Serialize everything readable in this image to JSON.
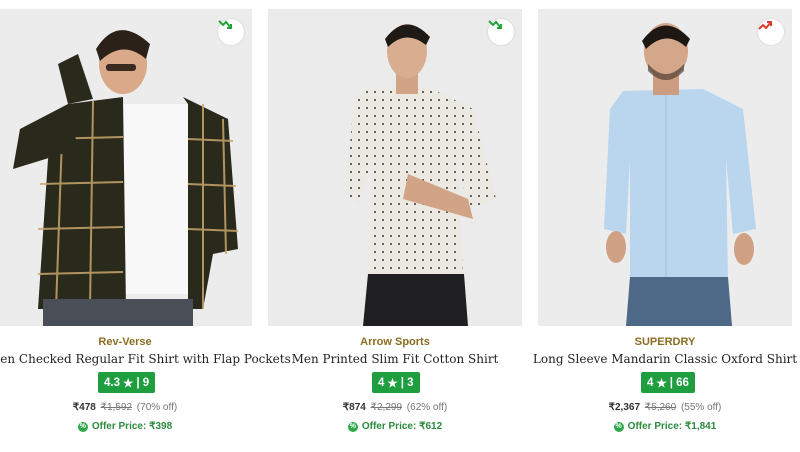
{
  "products": [
    {
      "brand": "Rev-Verse",
      "title": "Men Checked Regular Fit Shirt with Flap Pockets",
      "rating": "4.3",
      "reviews": "| 9",
      "price": "₹478",
      "mrp": "₹1,592",
      "discount": "(70% off)",
      "offer_price": "Offer Price: ₹398",
      "trend": "trending-down-icon",
      "trend_color": "#22a33a"
    },
    {
      "brand": "Arrow Sports",
      "title": "Men Printed Slim Fit Cotton Shirt",
      "rating": "4",
      "reviews": "| 3",
      "price": "₹874",
      "mrp": "₹2,299",
      "discount": "(62% off)",
      "offer_price": "Offer Price: ₹612",
      "trend": "trending-down-icon",
      "trend_color": "#22a33a"
    },
    {
      "brand": "SUPERDRY",
      "title": "Long Sleeve Mandarin Classic Oxford Shirt",
      "rating": "4",
      "reviews": "| 66",
      "price": "₹2,367",
      "mrp": "₹5,260",
      "discount": "(55% off)",
      "offer_price": "Offer Price: ₹1,841",
      "trend": "trending-up-icon",
      "trend_color": "#e03b2d"
    }
  ],
  "colors": {
    "brand_text": "#8a6d1f",
    "rating_badge": "#1e9e3e",
    "offer_text": "#2b8a3e"
  }
}
